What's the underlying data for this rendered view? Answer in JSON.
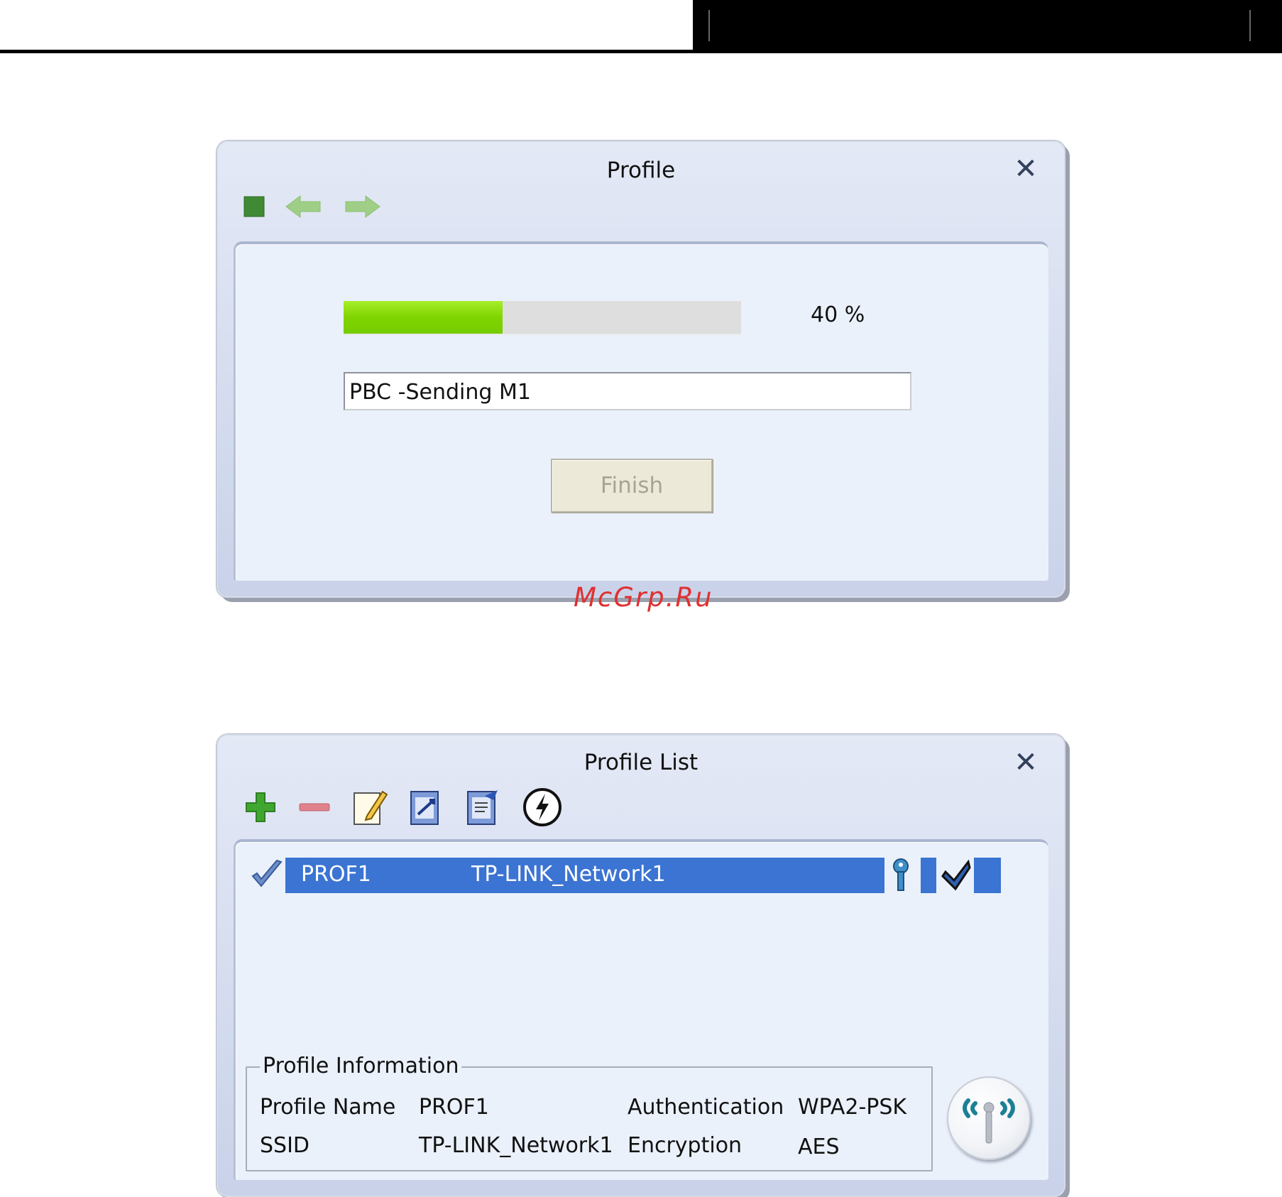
{
  "profile_dialog": {
    "title": "Profile",
    "progress_percent": 40,
    "progress_label": "40 %",
    "status_text": "PBC -Sending M1",
    "finish_label": "Finish",
    "icons": [
      "stop-icon",
      "back-arrow-icon",
      "forward-arrow-icon",
      "close-icon"
    ]
  },
  "watermark": "McGrp.Ru",
  "profile_list_dialog": {
    "title": "Profile List",
    "toolbar_icons": [
      "add-icon",
      "remove-icon",
      "edit-icon",
      "import-icon",
      "export-icon",
      "wps-icon"
    ],
    "rows": [
      {
        "profile_name": "PROF1",
        "ssid": "TP-LINK_Network1",
        "selected": true
      }
    ],
    "info": {
      "group_label": "Profile Information",
      "profile_name_label": "Profile Name",
      "profile_name_value": "PROF1",
      "ssid_label": "SSID",
      "ssid_value": "TP-LINK_Network1",
      "auth_label": "Authentication",
      "auth_value": "WPA2-PSK",
      "enc_label": "Encryption",
      "enc_value": "AES"
    }
  },
  "colors": {
    "selection": "#3b74d2",
    "progress": "#7fd400",
    "accent_teal": "#1c7f95"
  }
}
